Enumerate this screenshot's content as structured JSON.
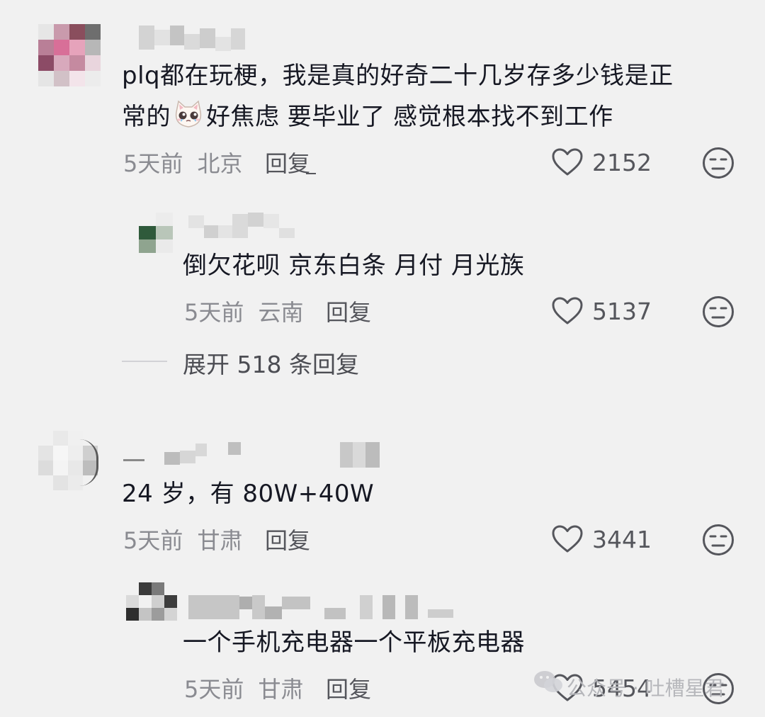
{
  "comments": [
    {
      "text_line1": "plq都在玩梗，我是真的好奇二十几岁存多少钱是正",
      "text_line2_before_emoji": "常的",
      "emoji": "crying-cat-emoji",
      "text_line2_after_emoji": "好焦虑 要毕业了 感觉根本找不到工作",
      "time": "5天前",
      "location": "北京",
      "reply_label": "回复",
      "likes": "2152"
    },
    {
      "text": "倒欠花呗 京东白条 月付 月光族",
      "time": "5天前",
      "location": "云南",
      "reply_label": "回复",
      "likes": "5137"
    },
    {
      "text": "24 岁，有 80W+40W",
      "time": "5天前",
      "location": "甘肃",
      "reply_label": "回复",
      "likes": "3441"
    },
    {
      "text": "一个手机充电器一个平板充电器",
      "time": "5天前",
      "location": "甘肃",
      "reply_label": "回复",
      "likes": "5454"
    }
  ],
  "expand_replies_label": "展开 518 条回复",
  "watermark": "公众号 · 吐槽星君",
  "icons": {
    "like": "heart-outline-icon",
    "dislike": "neutral-face-icon",
    "watermark_logo": "wechat-icon"
  },
  "colors": {
    "background": "#f1f1f1",
    "text_primary": "#161823",
    "text_meta": "#8a8b91",
    "icon_stroke": "#55565c"
  }
}
